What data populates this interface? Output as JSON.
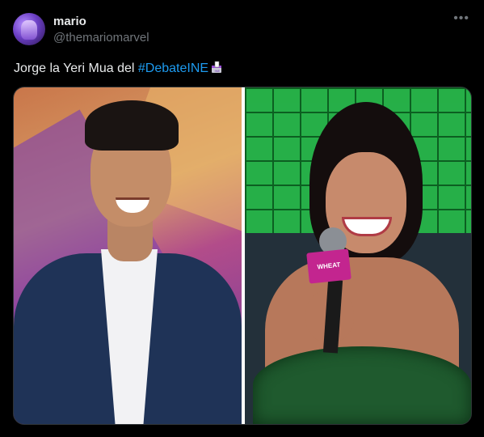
{
  "tweet": {
    "author_name": "mario",
    "author_handle": "@themariomarvel",
    "more_icon": "more-options-icon",
    "text_prefix": "Jorge la Yeri Mua del ",
    "hashtag": "#DebateINE",
    "hashtag_emoji": "ballot-box-icon"
  },
  "media": {
    "left_image": "man-in-suit-smiling-photo",
    "right_image": "woman-with-microphone-smiling-photo",
    "mic_flag_text": "WHEAT",
    "accent_colors": {
      "hashtag": "#1d9bf0",
      "mic_flag": "#c3258f"
    }
  }
}
